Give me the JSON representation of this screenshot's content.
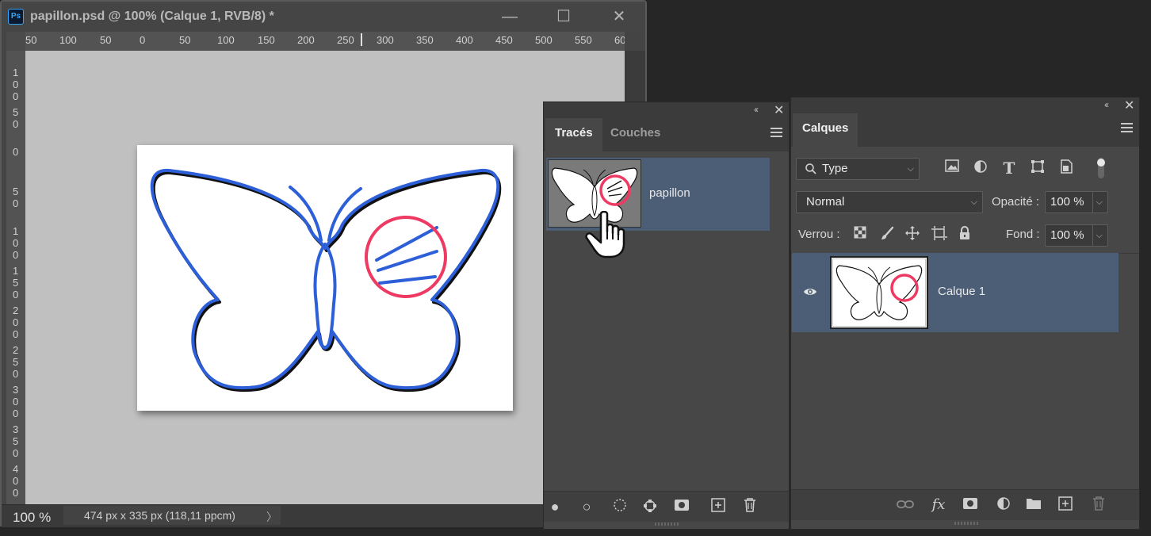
{
  "document": {
    "title": "papillon.psd @ 100% (Calque 1, RVB/8) *",
    "app_icon": "Ps",
    "window_buttons": [
      "minimize-icon",
      "maximize-icon",
      "close-icon"
    ],
    "ruler_top_labels": [
      "50",
      "100",
      "50",
      "0",
      "50",
      "100",
      "150",
      "200",
      "250",
      "300",
      "350",
      "400",
      "450",
      "500",
      "550",
      "60"
    ],
    "ruler_left_labels": [
      "100",
      "50",
      "0",
      "50",
      "100",
      "150",
      "200",
      "250",
      "300",
      "350",
      "400"
    ],
    "status_zoom": "100 %",
    "status_info": "474 px x 335 px (118,11 ppcm)",
    "status_arrow": "〉"
  },
  "paths_panel": {
    "tabs": [
      "Tracés",
      "Couches"
    ],
    "active_tab": 0,
    "collapse_glyph": "‹‹",
    "close_glyph": "✕",
    "paths": [
      {
        "name": "papillon"
      }
    ],
    "footer_icons": [
      "fill-path-icon",
      "stroke-path-icon",
      "load-selection-icon",
      "make-work-path-icon",
      "add-mask-icon",
      "new-path-icon",
      "delete-path-icon"
    ]
  },
  "layers_panel": {
    "tab": "Calques",
    "collapse_glyph": "‹‹",
    "close_glyph": "✕",
    "filter_type": "Type",
    "blend_mode": "Normal",
    "opacity_label": "Opacité :",
    "opacity_value": "100 %",
    "lock_label": "Verrou :",
    "fill_label": "Fond :",
    "fill_value": "100 %",
    "filter_icons": [
      "image-filter-icon",
      "adjustment-filter-icon",
      "type-filter-icon",
      "shape-filter-icon",
      "smart-object-filter-icon",
      "filter-toggle-icon"
    ],
    "lock_icons": [
      "lock-transparency-icon",
      "lock-image-icon",
      "lock-position-icon",
      "lock-artboard-icon",
      "lock-all-icon"
    ],
    "layers": [
      {
        "name": "Calque 1",
        "visible": true
      }
    ],
    "footer_icons": [
      "link-layers-icon",
      "fx-icon",
      "add-mask-icon",
      "adjustment-layer-icon",
      "group-folder-icon",
      "new-layer-icon",
      "delete-layer-icon"
    ]
  },
  "colors": {
    "accent_path": "#2d5fd8",
    "highlight_circle": "#ee3a63",
    "selection_row": "#4b5e76"
  }
}
